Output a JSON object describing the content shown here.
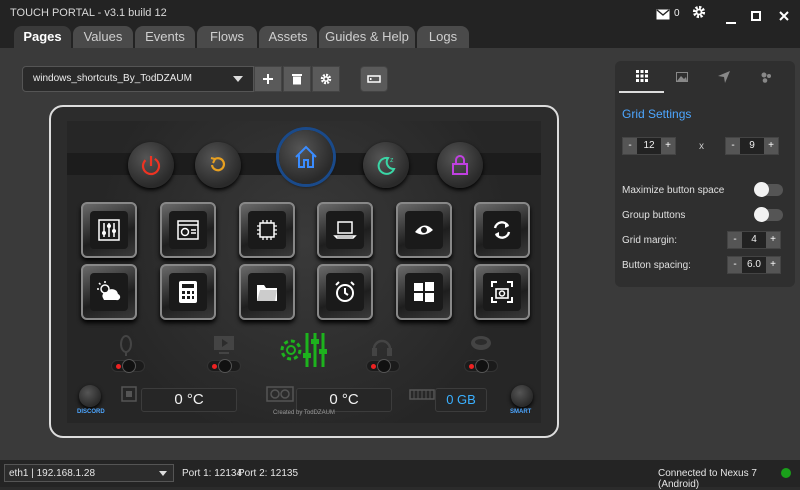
{
  "app": {
    "title": "TOUCH PORTAL - v3.1 build 12",
    "mail_count": "0"
  },
  "tabs": [
    {
      "label": "Pages"
    },
    {
      "label": "Values"
    },
    {
      "label": "Events"
    },
    {
      "label": "Flows"
    },
    {
      "label": "Assets"
    },
    {
      "label": "Guides & Help"
    },
    {
      "label": "Logs"
    }
  ],
  "toolbar": {
    "page_name": "windows_shortcuts_By_TodDZAUM"
  },
  "device": {
    "readout_1": "0 °C",
    "readout_2": "0 °C",
    "readout_3": "0 GB",
    "discord_label": "DISCORD",
    "smart_label": "SMART",
    "credit": "Created by TodDZAUM"
  },
  "settings": {
    "title": "Grid Settings",
    "grid_cols": "12",
    "grid_x": "x",
    "grid_rows": "9",
    "maximize_label": "Maximize button space",
    "group_label": "Group buttons",
    "margin_label": "Grid margin:",
    "margin_value": "4",
    "spacing_label": "Button spacing:",
    "spacing_value": "6.0"
  },
  "status": {
    "interface": "eth1 | 192.168.1.28",
    "port1": "Port 1: 12134",
    "port2": "Port 2: 12135",
    "connection": "Connected to Nexus 7 (Android)"
  },
  "colors": {
    "accent_green": "#1a9f1a",
    "accent_blue": "#4da6ff"
  }
}
